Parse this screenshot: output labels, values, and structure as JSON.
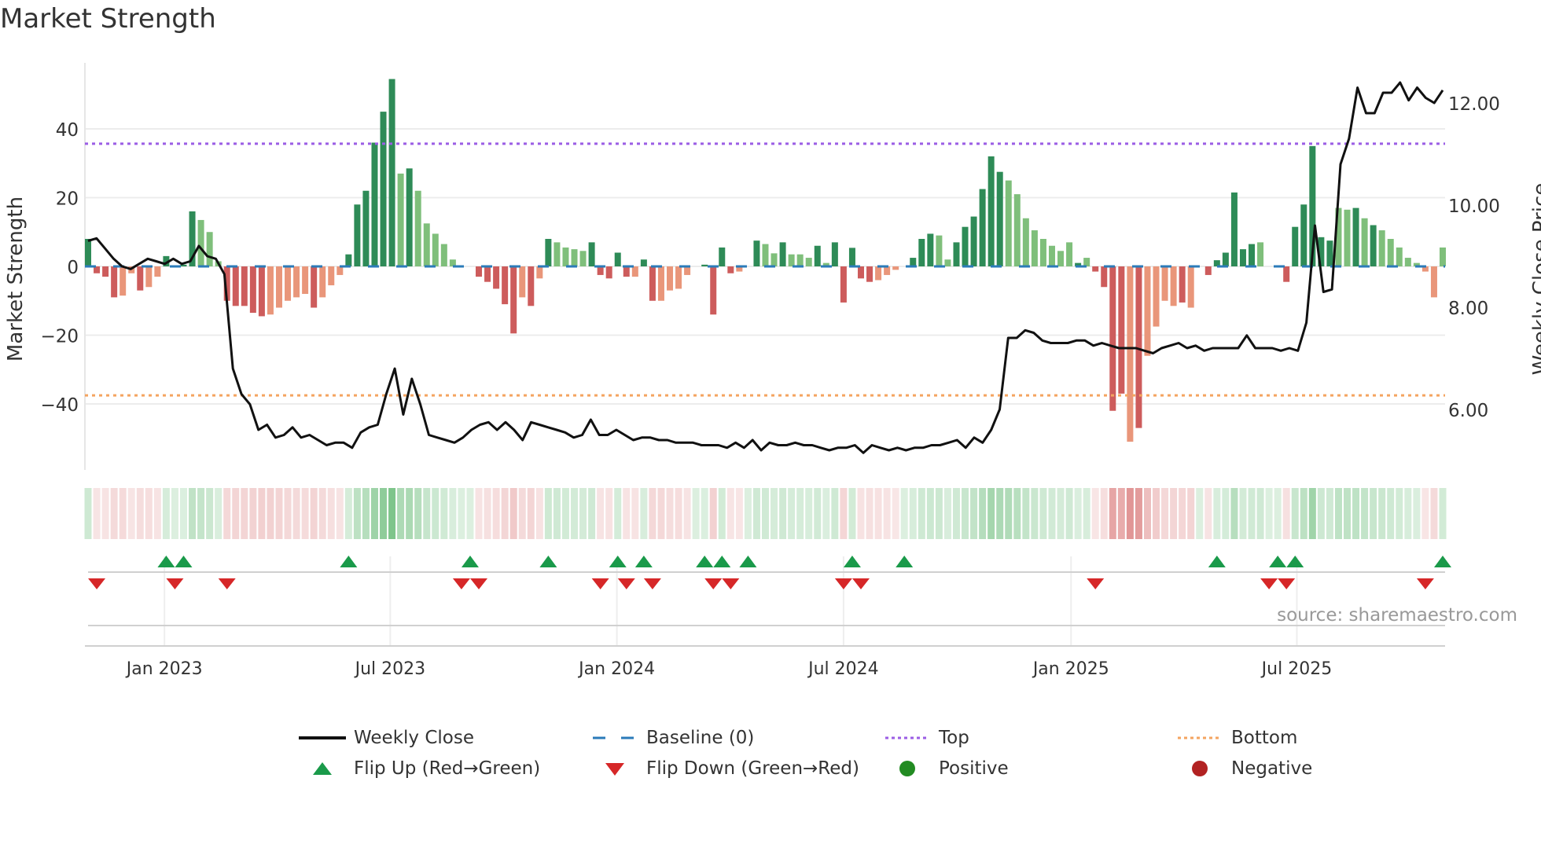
{
  "title": "Market Strength",
  "source": "source: sharemaestro.com",
  "chart_data": {
    "type": "bar",
    "title": "Market Strength",
    "ylabel": "Market Strength",
    "y2label": "Weekly Close Price",
    "ylim": [
      -59,
      61
    ],
    "y2lim": [
      4.95,
      12.95
    ],
    "yticks": [
      -40,
      -20,
      0,
      20,
      40
    ],
    "ytick_labels": [
      "−40",
      "−20",
      "0",
      "20",
      "40"
    ],
    "y2ticks": [
      6,
      8,
      10,
      12
    ],
    "y2tick_labels": [
      "6.00",
      "8.00",
      "10.00",
      "12.00"
    ],
    "xticks": [
      8.8,
      34.8,
      60.9,
      87.0,
      113.2,
      139.2
    ],
    "xtick_labels": [
      "Jan 2023",
      "Jul 2023",
      "Jan 2024",
      "Jul 2024",
      "Jan 2025",
      "Jul 2025"
    ],
    "top_level": 35.7,
    "bottom_level": -37.5,
    "baseline": 0,
    "strength": [
      8,
      -2,
      -3,
      -9,
      -8.5,
      -2,
      -7,
      -6,
      -3,
      3,
      0,
      0.5,
      16,
      13.5,
      10,
      1.5,
      -10,
      -11.5,
      -11.5,
      -13.5,
      -14.5,
      -14,
      -12,
      -10,
      -9,
      -8,
      -12,
      -9,
      -5.5,
      -2.5,
      3.5,
      18,
      22,
      36,
      45,
      54.5,
      27,
      28.5,
      22,
      12.5,
      9.5,
      6.5,
      2,
      0,
      0,
      -3,
      -4.5,
      -6.5,
      -11,
      -19.5,
      -9,
      -11.5,
      -3.5,
      8,
      7,
      5.5,
      5,
      4.5,
      7,
      -2.5,
      -3.5,
      4,
      -3,
      -3,
      2,
      -10,
      -10,
      -7,
      -6.5,
      -2.5,
      0,
      0.5,
      -14,
      5.5,
      -2,
      -1.5,
      0,
      7.5,
      6.5,
      3.8,
      7,
      3.5,
      3.5,
      2.5,
      6,
      1,
      7,
      -10.5,
      5.4,
      -3.5,
      -4.5,
      -4,
      -2.5,
      -1,
      0,
      2.5,
      8,
      9.5,
      9,
      2,
      7,
      11.5,
      14.5,
      22.5,
      32,
      27.5,
      25,
      21,
      14,
      10.5,
      8,
      6,
      4.5,
      7,
      1,
      2.5,
      -1.5,
      -6,
      -42,
      -37,
      -51,
      -47,
      -26,
      -17.5,
      -10,
      -11.5,
      -10.5,
      -12,
      0,
      -2.5,
      1.8,
      4,
      21.5,
      5,
      6.5,
      7,
      0,
      0,
      -4.5,
      11.5,
      18,
      35,
      8.5,
      7.5,
      17,
      16.5,
      17,
      14,
      12,
      10.5,
      8,
      5.5,
      2.5,
      1,
      -1.5,
      -9,
      5.5
    ],
    "strength_shade": "DDDDLLDLLDDDDLLLDDDDDLLLLLDLLLDDDDDDLDLLLLLDDDDDDDLDLDLLLLDDDDDLDDLLLLDDDDDLDDLLDLLLDLDDDDDLLLDDDDLLDDDDDDLLLLLLLLDLDDDDLDLLLLDLDDDDDDDLDDDDDDDDLLDLDLLLLLLLLDD",
    "weekly_close": [
      9.3,
      9.35,
      9.15,
      8.95,
      8.8,
      8.75,
      8.85,
      8.95,
      8.9,
      8.85,
      8.95,
      8.85,
      8.9,
      9.2,
      9.0,
      8.95,
      8.65,
      6.8,
      6.3,
      6.1,
      5.6,
      5.7,
      5.45,
      5.5,
      5.65,
      5.45,
      5.5,
      5.4,
      5.3,
      5.35,
      5.35,
      5.25,
      5.55,
      5.65,
      5.7,
      6.3,
      6.8,
      5.9,
      6.6,
      6.1,
      5.5,
      5.45,
      5.4,
      5.35,
      5.45,
      5.6,
      5.7,
      5.75,
      5.6,
      5.75,
      5.6,
      5.4,
      5.75,
      5.7,
      5.65,
      5.6,
      5.55,
      5.45,
      5.5,
      5.8,
      5.5,
      5.5,
      5.6,
      5.5,
      5.4,
      5.45,
      5.45,
      5.4,
      5.4,
      5.35,
      5.35,
      5.35,
      5.3,
      5.3,
      5.3,
      5.25,
      5.35,
      5.25,
      5.4,
      5.2,
      5.35,
      5.3,
      5.3,
      5.35,
      5.3,
      5.3,
      5.25,
      5.2,
      5.25,
      5.25,
      5.3,
      5.15,
      5.3,
      5.25,
      5.2,
      5.25,
      5.2,
      5.25,
      5.25,
      5.3,
      5.3,
      5.35,
      5.4,
      5.25,
      5.45,
      5.35,
      5.6,
      6.0,
      7.4,
      7.4,
      7.55,
      7.5,
      7.35,
      7.3,
      7.3,
      7.3,
      7.35,
      7.35,
      7.25,
      7.3,
      7.25,
      7.2,
      7.2,
      7.2,
      7.15,
      7.1,
      7.2,
      7.25,
      7.3,
      7.2,
      7.25,
      7.15,
      7.2,
      7.2,
      7.2,
      7.2,
      7.45,
      7.2,
      7.2,
      7.2,
      7.15,
      7.2,
      7.15,
      7.7,
      9.6,
      8.3,
      8.35,
      10.8,
      11.3,
      12.3,
      11.8,
      11.8,
      12.2,
      12.2,
      12.4,
      12.05,
      12.3,
      12.1,
      12.0,
      12.25
    ],
    "flip_up_weeks": [
      9,
      11,
      30,
      44,
      53,
      61,
      64,
      71,
      73,
      76,
      88,
      94,
      130,
      137,
      139,
      156
    ],
    "flip_down_weeks": [
      1,
      10,
      16,
      43,
      45,
      59,
      62,
      65,
      72,
      74,
      87,
      89,
      116,
      136,
      138,
      154
    ],
    "colors": {
      "positive_strong": "#2e8b57",
      "positive_weak": "#7fbf7b",
      "negative_strong": "#cd5c5c",
      "negative_weak": "#e9967a",
      "baseline": "#2b7bb9",
      "top": "#9b5de5",
      "bottom": "#f4a460",
      "flip_up": "#1a9a4a",
      "flip_down": "#d62728",
      "positive_dot": "#228b22",
      "negative_dot": "#b22222"
    },
    "legend": [
      {
        "label": "Weekly Close",
        "symbol": "line"
      },
      {
        "label": "Baseline (0)",
        "symbol": "dash"
      },
      {
        "label": "Top",
        "symbol": "dot-purple"
      },
      {
        "label": "Bottom",
        "symbol": "dot-orange"
      },
      {
        "label": "Flip Up (Red→Green)",
        "symbol": "tri-up"
      },
      {
        "label": "Flip Down (Green→Red)",
        "symbol": "tri-down"
      },
      {
        "label": "Positive",
        "symbol": "circle-green"
      },
      {
        "label": "Negative",
        "symbol": "circle-red"
      }
    ],
    "legend_position": "bottom"
  }
}
